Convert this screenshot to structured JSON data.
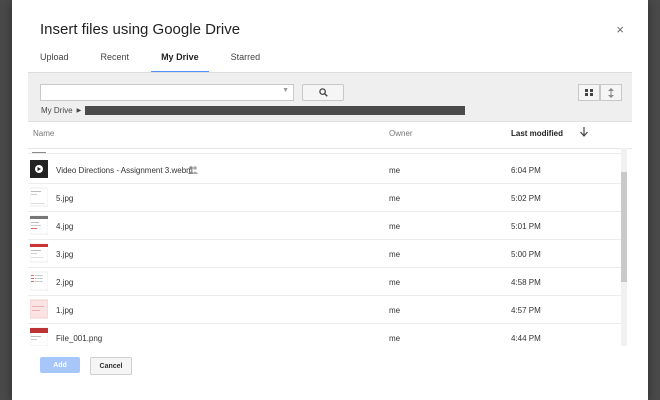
{
  "dialog": {
    "title": "Insert files using Google Drive",
    "close_label": "×"
  },
  "tabs": [
    {
      "label": "Upload"
    },
    {
      "label": "Recent"
    },
    {
      "label": "My Drive"
    },
    {
      "label": "Starred"
    }
  ],
  "search": {
    "placeholder": ""
  },
  "breadcrumb": {
    "root": "My Drive"
  },
  "columns": {
    "name": "Name",
    "owner": "Owner",
    "modified": "Last modified"
  },
  "files": [
    {
      "name": "Video Directions - Assignment 3.webm",
      "owner": "me",
      "modified": "6:04 PM",
      "thumb_icon": "video-thumbnail",
      "shared": true
    },
    {
      "name": "5.jpg",
      "owner": "me",
      "modified": "5:02 PM",
      "thumb_icon": "image-thumbnail"
    },
    {
      "name": "4.jpg",
      "owner": "me",
      "modified": "5:01 PM",
      "thumb_icon": "image-thumbnail"
    },
    {
      "name": "3.jpg",
      "owner": "me",
      "modified": "5:00 PM",
      "thumb_icon": "image-thumbnail"
    },
    {
      "name": "2.jpg",
      "owner": "me",
      "modified": "4:58 PM",
      "thumb_icon": "image-thumbnail"
    },
    {
      "name": "1.jpg",
      "owner": "me",
      "modified": "4:57 PM",
      "thumb_icon": "image-thumbnail"
    },
    {
      "name": "File_001.png",
      "owner": "me",
      "modified": "4:44 PM",
      "thumb_icon": "image-thumbnail"
    }
  ],
  "actions": {
    "add_label": "Add",
    "cancel_label": "Cancel"
  },
  "colors": {
    "accent": "#4d90fe",
    "add_disabled": "#a7c7fb"
  }
}
